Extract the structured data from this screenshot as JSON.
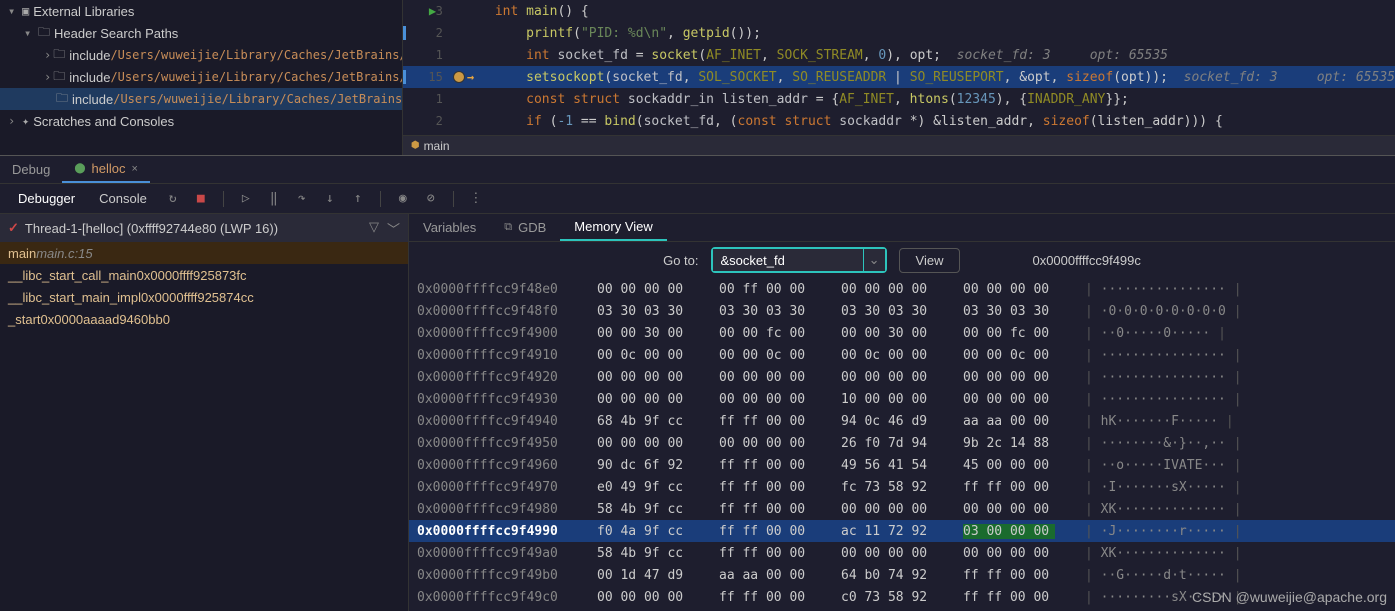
{
  "tree": {
    "ext_libs": "External Libraries",
    "header_paths": "Header Search Paths",
    "include_label": "include",
    "include_path": "/Users/wuweijie/Library/Caches/JetBrains/CL",
    "scratches": "Scratches and Consoles"
  },
  "code": {
    "lines": [
      {
        "n": "3",
        "html": "<span class='kw'>int</span> <span class='fn'>main</span>() {"
      },
      {
        "n": "2",
        "html": "    <span class='fn'>printf</span>(<span class='str'>\"PID: %d\\n\"</span>, <span class='fn'>getpid</span>());"
      },
      {
        "n": "1",
        "html": "    <span class='kw'>int</span> <span class='var'>socket_fd</span> = <span class='fn'>socket</span>(<span class='macro'>AF_INET</span>, <span class='macro'>SOCK_STREAM</span>, <span class='num'>0</span>), opt;  <span class='comment-inline'>socket_fd: 3     opt: 65535</span>"
      },
      {
        "n": "15",
        "html": "    <span class='fn'>setsockopt</span>(<span class='var'>socket_fd</span>, <span class='macro'>SOL_SOCKET</span>, <span class='macro'>SO_REUSEADDR</span> | <span class='macro'>SO_REUSEPORT</span>, &opt, <span class='kw'>sizeof</span>(opt));  <span class='comment-inline'>socket_fd: 3     opt: 65535</span>"
      },
      {
        "n": "1",
        "html": "    <span class='kw'>const struct</span> <span class='var'>sockaddr_in</span> <span class='var'>listen_addr</span> = {<span class='macro'>AF_INET</span>, <span class='fn'>htons</span>(<span class='num'>12345</span>), {<span class='macro'>INADDR_ANY</span>}};"
      },
      {
        "n": "2",
        "html": "    <span class='kw'>if</span> (<span class='num'>-1</span> == <span class='fn'>bind</span>(<span class='var'>socket_fd</span>, (<span class='kw'>const struct</span> <span class='var'>sockaddr</span> *) &listen_addr, <span class='kw'>sizeof</span>(listen_addr))) {"
      }
    ],
    "breadcrumb": "main"
  },
  "debug": {
    "tab_debug": "Debug",
    "tab_helloc": "helloc",
    "tab_debugger": "Debugger",
    "tab_console": "Console"
  },
  "threads": {
    "title": "Thread-1-[helloc] (0xffff92744e80 (LWP 16))",
    "frames": [
      {
        "fn": "main",
        "loc": "main.c:15"
      },
      {
        "fn": "__libc_start_call_main",
        "addr": "0x0000ffff925873fc"
      },
      {
        "fn": "__libc_start_main_impl",
        "addr": "0x0000ffff925874cc"
      },
      {
        "fn": "_start",
        "addr": "0x0000aaaad9460bb0"
      }
    ]
  },
  "mem": {
    "tab_vars": "Variables",
    "tab_gdb": "GDB",
    "tab_memview": "Memory View",
    "goto_label": "Go to:",
    "goto_value": "&socket_fd",
    "view_btn": "View",
    "goto_addr": "0x0000ffffcc9f499c",
    "rows": [
      {
        "a": "0x0000ffffcc9f48e0",
        "g": [
          "00 00 00 00",
          "00 ff 00 00",
          "00 00 00 00",
          "00 00 00 00"
        ],
        "asc": "················"
      },
      {
        "a": "0x0000ffffcc9f48f0",
        "g": [
          "03 30 03 30",
          "03 30 03 30",
          "03 30 03 30",
          "03 30 03 30"
        ],
        "asc": "·0·0·0·0·0·0·0·0"
      },
      {
        "a": "0x0000ffffcc9f4900",
        "g": [
          "00 00 30 00",
          "00 00 fc 00",
          "00 00 30 00",
          "00 00 fc 00"
        ],
        "asc": "··0·····0·····"
      },
      {
        "a": "0x0000ffffcc9f4910",
        "g": [
          "00 0c 00 00",
          "00 00 0c 00",
          "00 0c 00 00",
          "00 00 0c 00"
        ],
        "asc": "················"
      },
      {
        "a": "0x0000ffffcc9f4920",
        "g": [
          "00 00 00 00",
          "00 00 00 00",
          "00 00 00 00",
          "00 00 00 00"
        ],
        "asc": "················"
      },
      {
        "a": "0x0000ffffcc9f4930",
        "g": [
          "00 00 00 00",
          "00 00 00 00",
          "10 00 00 00",
          "00 00 00 00"
        ],
        "asc": "················"
      },
      {
        "a": "0x0000ffffcc9f4940",
        "g": [
          "68 4b 9f cc",
          "ff ff 00 00",
          "94 0c 46 d9",
          "aa aa 00 00"
        ],
        "asc": "hK·······F·····"
      },
      {
        "a": "0x0000ffffcc9f4950",
        "g": [
          "00 00 00 00",
          "00 00 00 00",
          "26 f0 7d 94",
          "9b 2c 14 88"
        ],
        "asc": "········&·}··,··"
      },
      {
        "a": "0x0000ffffcc9f4960",
        "g": [
          "90 dc 6f 92",
          "ff ff 00 00",
          "49 56 41 54",
          "45 00 00 00"
        ],
        "asc": "··o·····IVATE···"
      },
      {
        "a": "0x0000ffffcc9f4970",
        "g": [
          "e0 49 9f cc",
          "ff ff 00 00",
          "fc 73 58 92",
          "ff ff 00 00"
        ],
        "asc": "·I·······sX·····"
      },
      {
        "a": "0x0000ffffcc9f4980",
        "g": [
          "58 4b 9f cc",
          "ff ff 00 00",
          "00 00 00 00",
          "00 00 00 00"
        ],
        "asc": "XK··············"
      },
      {
        "a": "0x0000ffffcc9f4990",
        "g": [
          "f0 4a 9f cc",
          "ff ff 00 00",
          "ac 11 72 92",
          "03 00 00 00"
        ],
        "asc": "·J········r·····",
        "hl": true,
        "g4hl": true
      },
      {
        "a": "0x0000ffffcc9f49a0",
        "g": [
          "58 4b 9f cc",
          "ff ff 00 00",
          "00 00 00 00",
          "00 00 00 00"
        ],
        "asc": "XK··············"
      },
      {
        "a": "0x0000ffffcc9f49b0",
        "g": [
          "00 1d 47 d9",
          "aa aa 00 00",
          "64 b0 74 92",
          "ff ff 00 00"
        ],
        "asc": "··G·····d·t·····"
      },
      {
        "a": "0x0000ffffcc9f49c0",
        "g": [
          "00 00 00 00",
          "ff ff 00 00",
          "c0 73 58 92",
          "ff ff 00 00"
        ],
        "asc": "·········sX·····"
      }
    ]
  },
  "watermark": "CSDN @wuweijie@apache.org"
}
